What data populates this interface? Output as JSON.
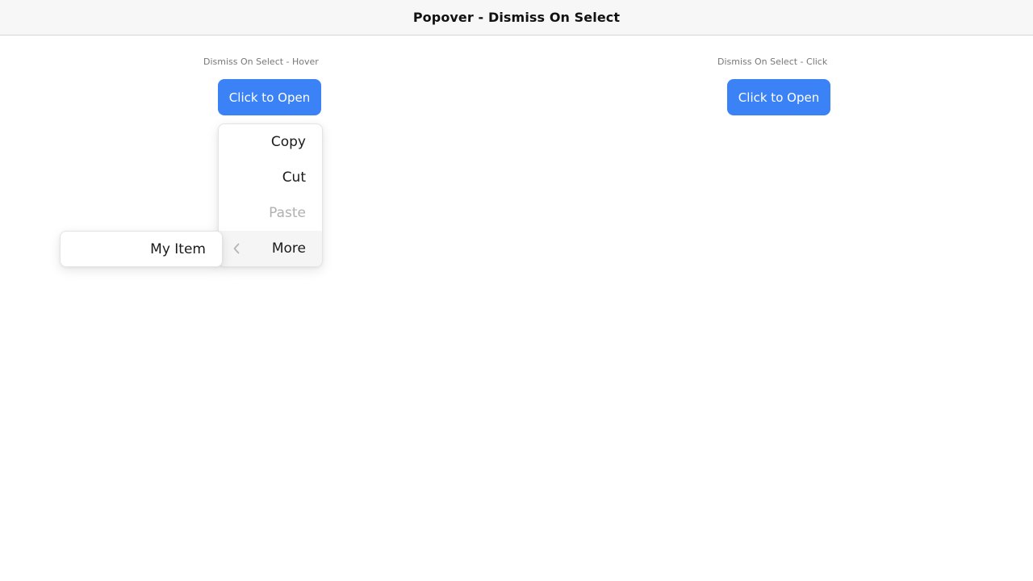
{
  "page": {
    "title": "Popover - Dismiss On Select"
  },
  "demos": {
    "hover": {
      "label": "Dismiss On Select - Hover",
      "button_label": "Click to Open"
    },
    "click": {
      "label": "Dismiss On Select - Click",
      "button_label": "Click to Open"
    }
  },
  "menu": {
    "items": [
      {
        "label": "Copy",
        "disabled": false
      },
      {
        "label": "Cut",
        "disabled": false
      },
      {
        "label": "Paste",
        "disabled": true
      },
      {
        "label": "More",
        "disabled": false,
        "submenu": true
      }
    ]
  },
  "submenu": {
    "items": [
      {
        "label": "My Item"
      }
    ]
  },
  "colors": {
    "accent": "#3b82f6",
    "disabled_text": "#b0b0b0",
    "header_bg": "#f7f7f7"
  },
  "icons": {
    "more_submenu": "chevron-left-icon"
  }
}
